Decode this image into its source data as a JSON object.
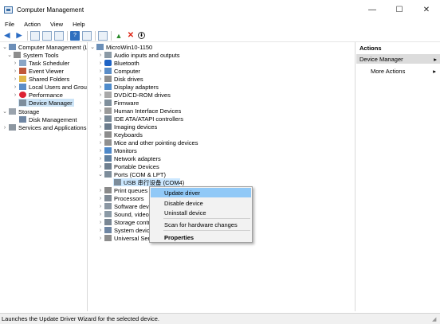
{
  "window": {
    "title": "Computer Management",
    "minimize_glyph": "—",
    "maximize_glyph": "☐",
    "close_glyph": "✕"
  },
  "menu": [
    "File",
    "Action",
    "View",
    "Help"
  ],
  "left_tree": {
    "root": "Computer Management (Local",
    "system_tools": "System Tools",
    "tools": [
      "Task Scheduler",
      "Event Viewer",
      "Shared Folders",
      "Local Users and Groups",
      "Performance",
      "Device Manager"
    ],
    "storage": "Storage",
    "disk_management": "Disk Management",
    "services": "Services and Applications"
  },
  "device_tree": {
    "computer": "MicroWin10-1150",
    "categories": [
      "Audio inputs and outputs",
      "Bluetooth",
      "Computer",
      "Disk drives",
      "Display adapters",
      "DVD/CD-ROM drives",
      "Firmware",
      "Human Interface Devices",
      "IDE ATA/ATAPI controllers",
      "Imaging devices",
      "Keyboards",
      "Mice and other pointing devices",
      "Monitors",
      "Network adapters",
      "Portable Devices",
      "Ports (COM & LPT)"
    ],
    "port_device": "USB 串行设备 (COM4)",
    "after": [
      "Print queues",
      "Processors",
      "Software devic",
      "Sound, video",
      "Storage contr",
      "System devic",
      "Universal Seri"
    ]
  },
  "context_menu": {
    "items": [
      "Update driver",
      "Disable device",
      "Uninstall device"
    ],
    "scan": "Scan for hardware changes",
    "properties": "Properties"
  },
  "actions": {
    "header": "Actions",
    "section": "Device Manager",
    "more": "More Actions",
    "arrow": "▸"
  },
  "status": "Launches the Update Driver Wizard for the selected device.",
  "colors": {
    "selection": "#cce4f7",
    "menu_highlight": "#91c9f7",
    "accent": "#2b6cc4"
  }
}
